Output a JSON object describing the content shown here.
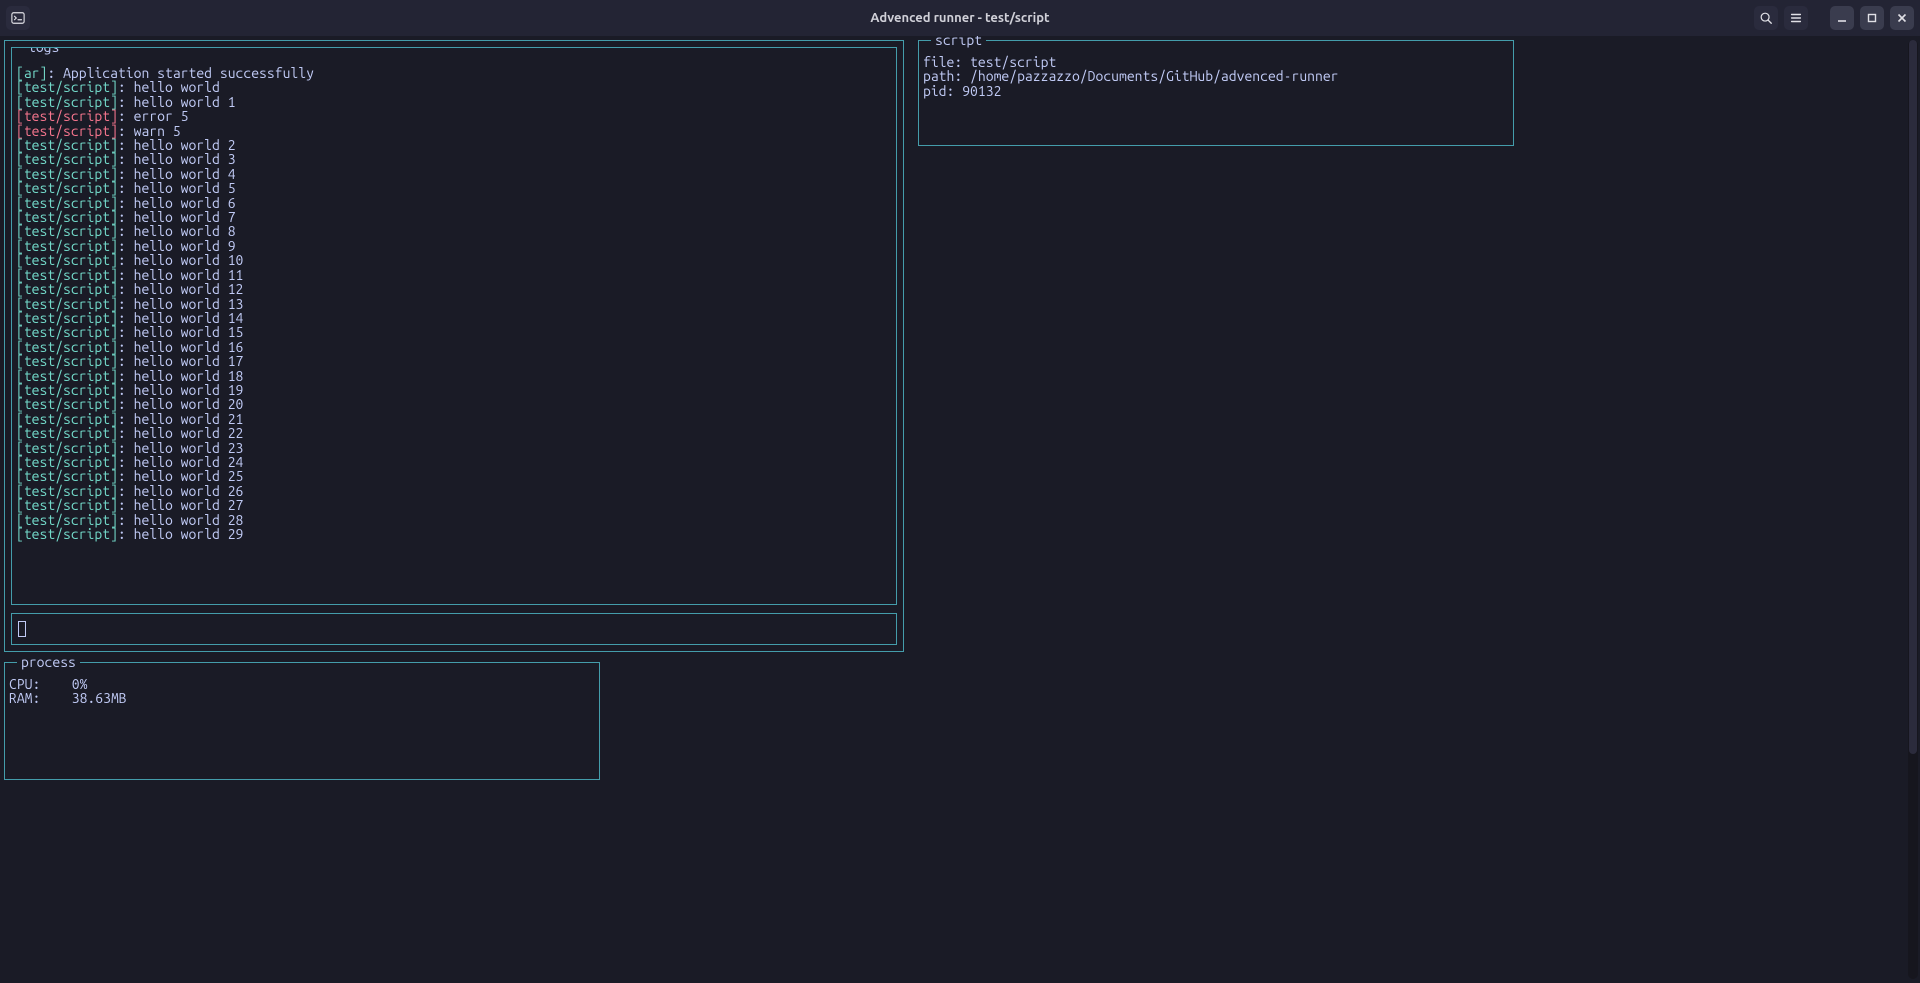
{
  "window": {
    "title": "Advenced runner - test/script"
  },
  "panels": {
    "logs_legend": "logs",
    "process_legend": "process",
    "script_legend": "script"
  },
  "logs": [
    {
      "tag": "[ar]",
      "color": "green",
      "msg": "Application started successfully"
    },
    {
      "tag": "[test/script]",
      "color": "green",
      "msg": "hello world"
    },
    {
      "tag": "[test/script]",
      "color": "green",
      "msg": "hello world 1"
    },
    {
      "tag": "[test/script]",
      "color": "red",
      "msg": "error 5"
    },
    {
      "tag": "[test/script]",
      "color": "red",
      "msg": "warn 5"
    },
    {
      "tag": "[test/script]",
      "color": "green",
      "msg": "hello world 2"
    },
    {
      "tag": "[test/script]",
      "color": "green",
      "msg": "hello world 3"
    },
    {
      "tag": "[test/script]",
      "color": "green",
      "msg": "hello world 4"
    },
    {
      "tag": "[test/script]",
      "color": "green",
      "msg": "hello world 5"
    },
    {
      "tag": "[test/script]",
      "color": "green",
      "msg": "hello world 6"
    },
    {
      "tag": "[test/script]",
      "color": "green",
      "msg": "hello world 7"
    },
    {
      "tag": "[test/script]",
      "color": "green",
      "msg": "hello world 8"
    },
    {
      "tag": "[test/script]",
      "color": "green",
      "msg": "hello world 9"
    },
    {
      "tag": "[test/script]",
      "color": "green",
      "msg": "hello world 10"
    },
    {
      "tag": "[test/script]",
      "color": "green",
      "msg": "hello world 11"
    },
    {
      "tag": "[test/script]",
      "color": "green",
      "msg": "hello world 12"
    },
    {
      "tag": "[test/script]",
      "color": "green",
      "msg": "hello world 13"
    },
    {
      "tag": "[test/script]",
      "color": "green",
      "msg": "hello world 14"
    },
    {
      "tag": "[test/script]",
      "color": "green",
      "msg": "hello world 15"
    },
    {
      "tag": "[test/script]",
      "color": "green",
      "msg": "hello world 16"
    },
    {
      "tag": "[test/script]",
      "color": "green",
      "msg": "hello world 17"
    },
    {
      "tag": "[test/script]",
      "color": "green",
      "msg": "hello world 18"
    },
    {
      "tag": "[test/script]",
      "color": "green",
      "msg": "hello world 19"
    },
    {
      "tag": "[test/script]",
      "color": "green",
      "msg": "hello world 20"
    },
    {
      "tag": "[test/script]",
      "color": "green",
      "msg": "hello world 21"
    },
    {
      "tag": "[test/script]",
      "color": "green",
      "msg": "hello world 22"
    },
    {
      "tag": "[test/script]",
      "color": "green",
      "msg": "hello world 23"
    },
    {
      "tag": "[test/script]",
      "color": "green",
      "msg": "hello world 24"
    },
    {
      "tag": "[test/script]",
      "color": "green",
      "msg": "hello world 25"
    },
    {
      "tag": "[test/script]",
      "color": "green",
      "msg": "hello world 26"
    },
    {
      "tag": "[test/script]",
      "color": "green",
      "msg": "hello world 27"
    },
    {
      "tag": "[test/script]",
      "color": "green",
      "msg": "hello world 28"
    },
    {
      "tag": "[test/script]",
      "color": "green",
      "msg": "hello world 29"
    }
  ],
  "process": {
    "cpu_label": "CPU:",
    "cpu_value": "0%",
    "ram_label": "RAM:",
    "ram_value": "38.63MB"
  },
  "script": {
    "file_label": "file:",
    "file_value": "test/script",
    "path_label": "path:",
    "path_value": "/home/pazzazzo/Documents/GitHub/advenced-runner",
    "pid_label": "pid:",
    "pid_value": "90132"
  }
}
